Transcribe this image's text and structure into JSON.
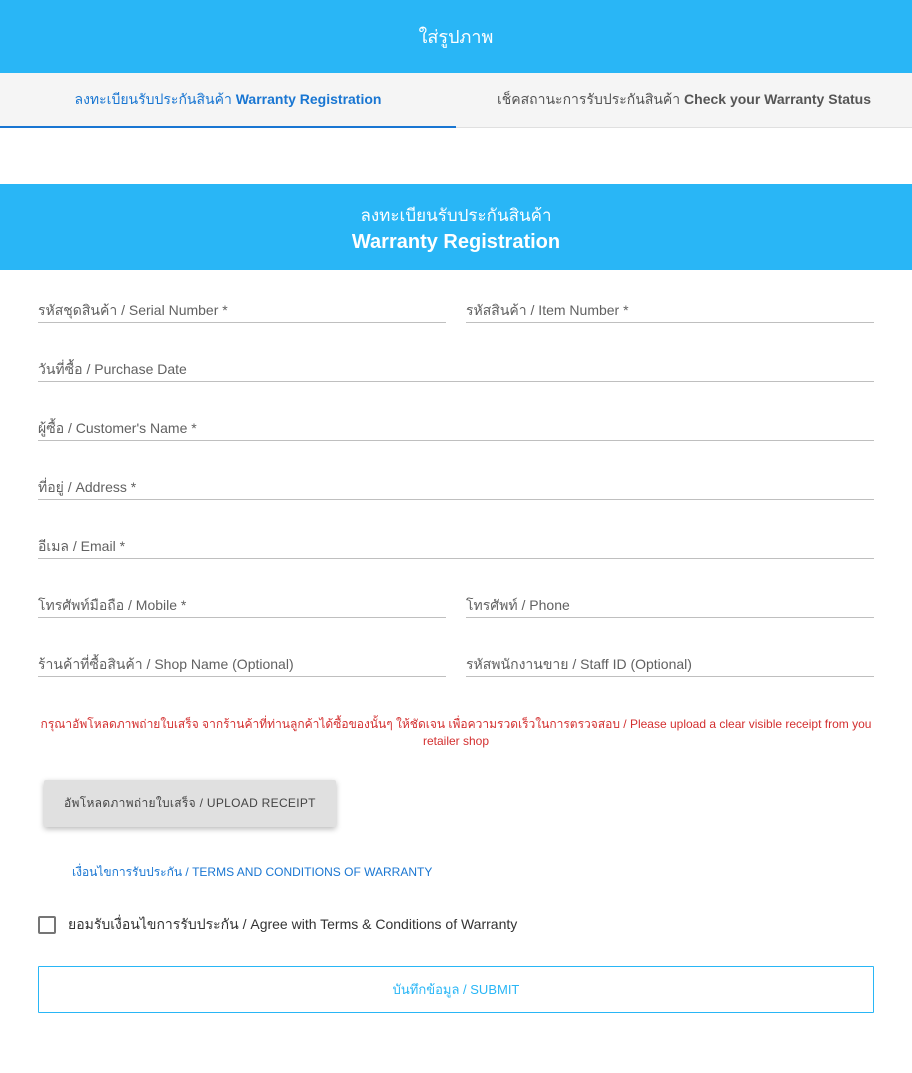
{
  "header": {
    "title": "ใส่รูปภาพ"
  },
  "tabs": {
    "register": {
      "prefix": "ลงทะเบียนรับประกันสินค้า ",
      "bold": "Warranty Registration"
    },
    "check": {
      "prefix": "เช็คสถานะการรับประกันสินค้า ",
      "bold": "Check your Warranty Status"
    }
  },
  "card": {
    "title_th": "ลงทะเบียนรับประกันสินค้า",
    "title_en": "Warranty Registration"
  },
  "fields": {
    "serial": "รหัสชุดสินค้า / Serial Number *",
    "item": "รหัสสินค้า / Item Number *",
    "purchase_date": "วันที่ซื้อ / Purchase Date",
    "customer": "ผู้ซื้อ / Customer's Name *",
    "address": "ที่อยู่ / Address *",
    "email": "อีเมล / Email *",
    "mobile": "โทรศัพท์มือถือ / Mobile *",
    "phone": "โทรศัพท์ / Phone",
    "shop": "ร้านค้าที่ซื้อสินค้า / Shop Name (Optional)",
    "staff": "รหัสพนักงานขาย / Staff ID (Optional)"
  },
  "notice": "กรุณาอัพโหลดภาพถ่ายใบเสร็จ จากร้านค้าที่ท่านลูกค้าได้ซื้อของนั้นๆ ให้ชัดเจน เพื่อความรวดเร็วในการตรวจสอบ / Please upload a clear visible receipt from you retailer shop",
  "buttons": {
    "upload": "อัพโหลดภาพถ่ายใบเสร็จ / UPLOAD RECEIPT",
    "submit": "บันทึกข้อมูล / SUBMIT"
  },
  "terms": {
    "link": "เงื่อนไขการรับประกัน / TERMS AND CONDITIONS OF WARRANTY",
    "agree": "ยอมรับเงื่อนไขการรับประกัน / Agree with Terms & Conditions of Warranty"
  }
}
